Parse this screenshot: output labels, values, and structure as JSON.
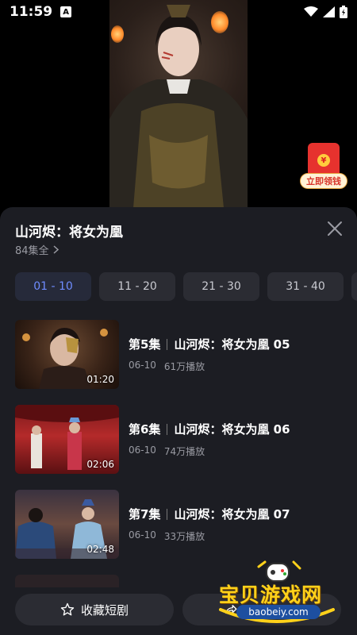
{
  "status": {
    "time": "11:59",
    "notification_icon": "A"
  },
  "promo": {
    "label": "立即领钱",
    "coin": "¥"
  },
  "series": {
    "title": "山河烬：将女为凰",
    "count_label": "84集全"
  },
  "range_tabs": [
    "01 - 10",
    "11 - 20",
    "21 - 30",
    "31 - 40"
  ],
  "episodes": [
    {
      "ep": "第5集",
      "name": "山河烬：将女为凰 05",
      "date": "06-10",
      "plays": "61万播放",
      "duration": "01:20"
    },
    {
      "ep": "第6集",
      "name": "山河烬：将女为凰 06",
      "date": "06-10",
      "plays": "74万播放",
      "duration": "02:06"
    },
    {
      "ep": "第7集",
      "name": "山河烬：将女为凰 07",
      "date": "06-10",
      "plays": "33万播放",
      "duration": "02:48"
    }
  ],
  "bottom": {
    "collect_label": "收藏短剧"
  },
  "watermark": {
    "text": "宝贝游戏网",
    "url": "baobeiy.com"
  },
  "colors": {
    "accent": "#6f8cff",
    "panel": "#1c1d23",
    "chip": "#2b2c33",
    "promo_red": "#e6322e"
  }
}
